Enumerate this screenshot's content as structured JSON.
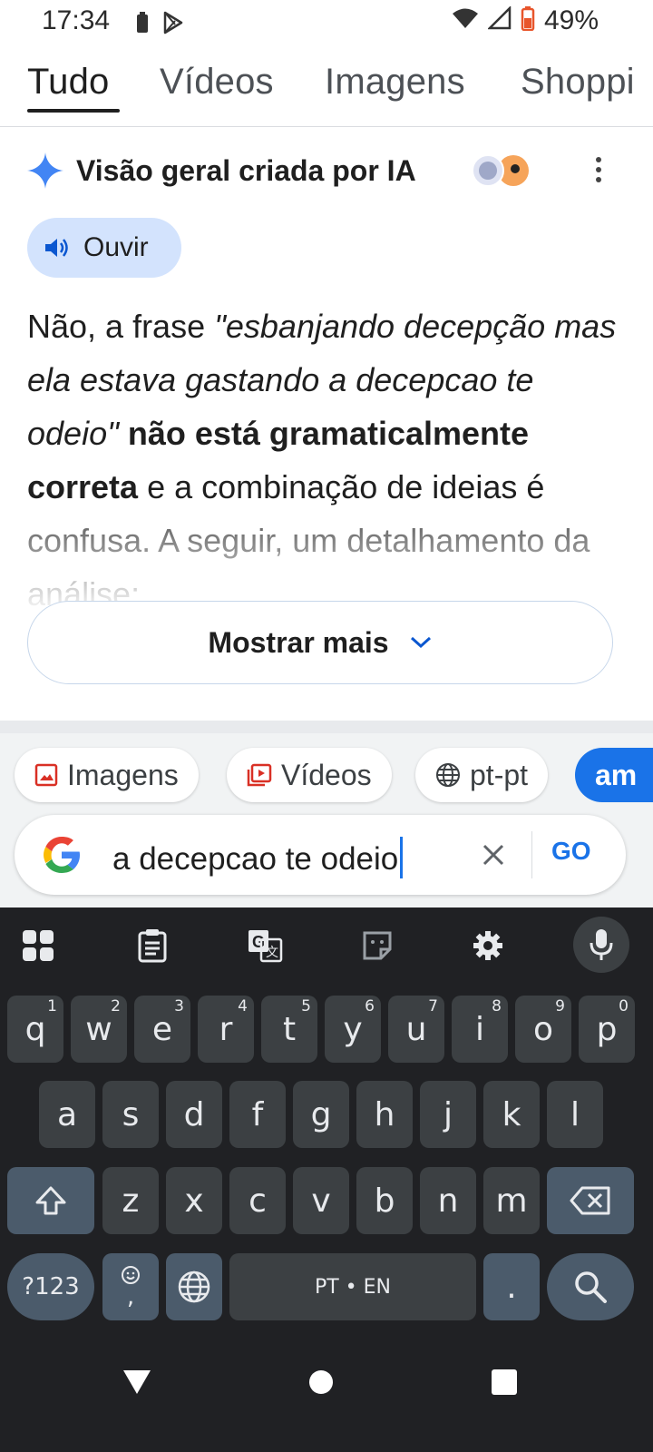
{
  "status_bar": {
    "time": "17:34",
    "battery_percent": "49%"
  },
  "tabs": [
    {
      "label": "Tudo",
      "active": true
    },
    {
      "label": "Vídeos",
      "active": false
    },
    {
      "label": "Imagens",
      "active": false
    },
    {
      "label": "Shoppi",
      "active": false
    }
  ],
  "ai_overview": {
    "title": "Visão geral criada por IA",
    "listen_label": "Ouvir",
    "text_prefix": "Não, a frase ",
    "text_quote": "\"esbanjando decepção mas ela estava gastando a decepcao te odeio\"",
    "text_bold": " não está gramaticalmente correta",
    "text_suffix": " e a combinação de ideias é confusa. A seguir, um detalhamento da análise:",
    "show_more_label": "Mostrar mais"
  },
  "chips": [
    {
      "label": "Imagens",
      "icon": "image-icon"
    },
    {
      "label": "Vídeos",
      "icon": "video-icon"
    },
    {
      "label": "pt-pt",
      "icon": "globe-icon"
    },
    {
      "label": "am",
      "icon": ""
    }
  ],
  "search": {
    "query": "a decepcao te odeio",
    "go_label": "GO"
  },
  "keyboard": {
    "row1": [
      {
        "k": "q",
        "h": "1"
      },
      {
        "k": "w",
        "h": "2"
      },
      {
        "k": "e",
        "h": "3"
      },
      {
        "k": "r",
        "h": "4"
      },
      {
        "k": "t",
        "h": "5"
      },
      {
        "k": "y",
        "h": "6"
      },
      {
        "k": "u",
        "h": "7"
      },
      {
        "k": "i",
        "h": "8"
      },
      {
        "k": "o",
        "h": "9"
      },
      {
        "k": "p",
        "h": "0"
      }
    ],
    "row2": [
      "a",
      "s",
      "d",
      "f",
      "g",
      "h",
      "j",
      "k",
      "l"
    ],
    "row3": [
      "z",
      "x",
      "c",
      "v",
      "b",
      "n",
      "m"
    ],
    "symbols_label": "?123",
    "emoji_comma": ",",
    "space_label": "PT • EN",
    "period_label": "."
  },
  "colors": {
    "accent": "#1a73e8",
    "listen_bg": "#d3e3fd",
    "keyboard_bg": "#202124",
    "key_bg": "#3c4043"
  }
}
